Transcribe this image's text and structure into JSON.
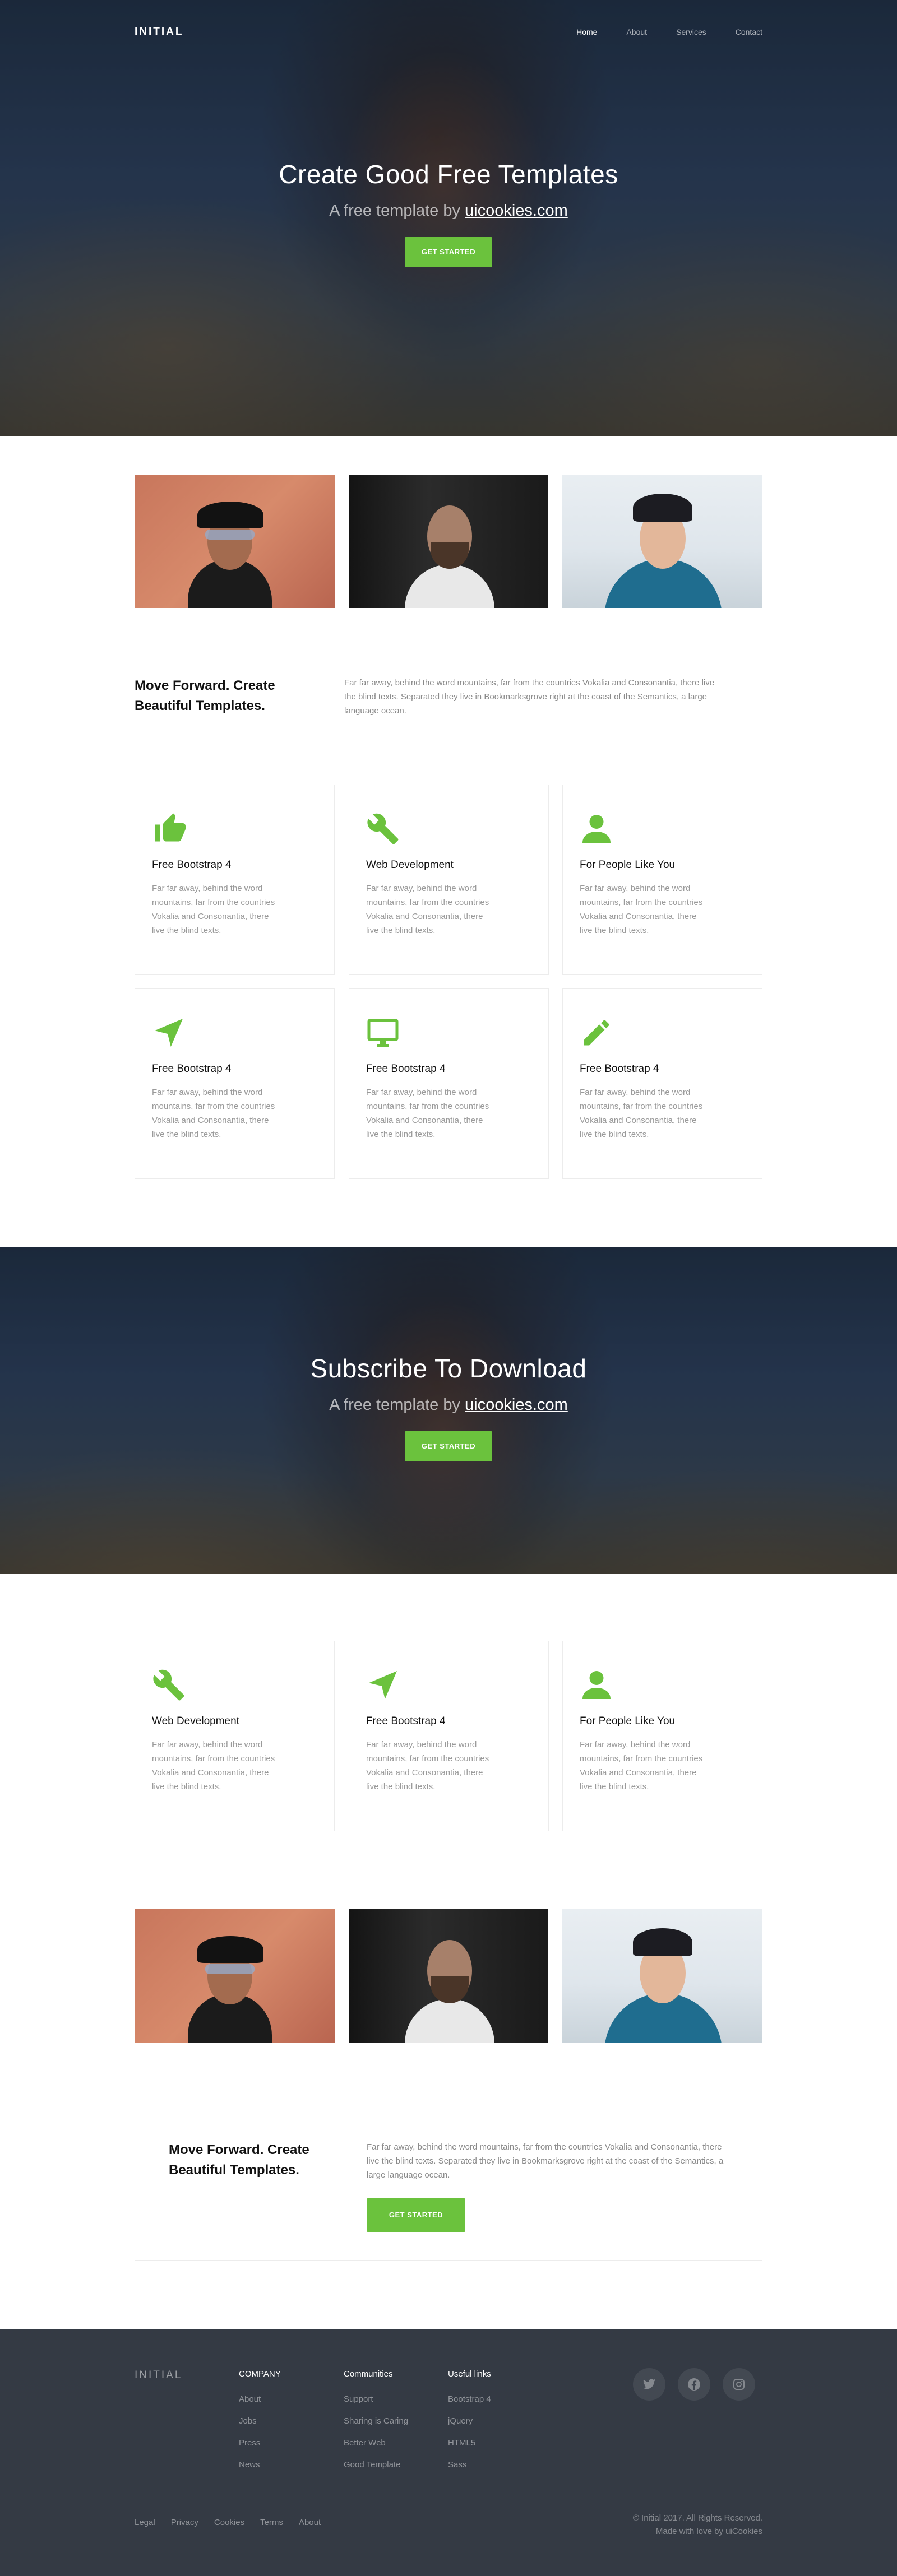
{
  "brand": {
    "logo": "INITIAL"
  },
  "nav": {
    "items": [
      {
        "label": "Home"
      },
      {
        "label": "About"
      },
      {
        "label": "Services"
      },
      {
        "label": "Contact"
      }
    ]
  },
  "hero": {
    "title": "Create Good Free Templates",
    "subtitle_prefix": "A free template by ",
    "subtitle_link": "uicookies.com",
    "button": "GET STARTED"
  },
  "intro": {
    "title": "Move Forward. Create Beautiful Templates.",
    "text": "Far far away, behind the word mountains, far from the countries Vokalia and Consonantia, there live the blind texts. Separated they live in Bookmarksgrove right at the coast of the Semantics, a large language ocean."
  },
  "features": [
    {
      "icon": "thumbs-up-icon",
      "title": "Free Bootstrap 4",
      "text": "Far far away, behind the word mountains, far from the countries Vokalia and Consonantia, there live the blind texts."
    },
    {
      "icon": "wrench-icon",
      "title": "Web Development",
      "text": "Far far away, behind the word mountains, far from the countries Vokalia and Consonantia, there live the blind texts."
    },
    {
      "icon": "user-icon",
      "title": "For People Like You",
      "text": "Far far away, behind the word mountains, far from the countries Vokalia and Consonantia, there live the blind texts."
    },
    {
      "icon": "navigation-arrow-icon",
      "title": "Free Bootstrap 4",
      "text": "Far far away, behind the word mountains, far from the countries Vokalia and Consonantia, there live the blind texts."
    },
    {
      "icon": "monitor-icon",
      "title": "Free Bootstrap 4",
      "text": "Far far away, behind the word mountains, far from the countries Vokalia and Consonantia, there live the blind texts."
    },
    {
      "icon": "pencil-icon",
      "title": "Free Bootstrap 4",
      "text": "Far far away, behind the word mountains, far from the countries Vokalia and Consonantia, there live the blind texts."
    }
  ],
  "subscribe": {
    "title": "Subscribe To Download",
    "subtitle_prefix": "A free template by ",
    "subtitle_link": "uicookies.com",
    "button": "GET STARTED"
  },
  "features2": [
    {
      "icon": "wrench-icon",
      "title": "Web Development",
      "text": "Far far away, behind the word mountains, far from the countries Vokalia and Consonantia, there live the blind texts."
    },
    {
      "icon": "navigation-arrow-icon",
      "title": "Free Bootstrap 4",
      "text": "Far far away, behind the word mountains, far from the countries Vokalia and Consonantia, there live the blind texts."
    },
    {
      "icon": "user-icon",
      "title": "For People Like You",
      "text": "Far far away, behind the word mountains, far from the countries Vokalia and Consonantia, there live the blind texts."
    }
  ],
  "cta": {
    "title": "Move Forward. Create Beautiful Templates.",
    "text": "Far far away, behind the word mountains, far from the countries Vokalia and Consonantia, there live the blind texts. Separated they live in Bookmarksgrove right at the coast of the Semantics, a large language ocean.",
    "button": "GET STARTED"
  },
  "footer": {
    "logo": "INITIAL",
    "columns": [
      {
        "heading": "COMPANY",
        "links": [
          "About",
          "Jobs",
          "Press",
          "News"
        ]
      },
      {
        "heading": "Communities",
        "links": [
          "Support",
          "Sharing is Caring",
          "Better Web",
          "Good Template"
        ]
      },
      {
        "heading": "Useful links",
        "links": [
          "Bootstrap 4",
          "jQuery",
          "HTML5",
          "Sass"
        ]
      }
    ],
    "socials": [
      "twitter-icon",
      "facebook-icon",
      "instagram-icon"
    ],
    "bottom_links": [
      "Legal",
      "Privacy",
      "Cookies",
      "Terms",
      "About"
    ],
    "copyright": "© Initial 2017. All Rights Reserved.",
    "credit": "Made with love by uiCookies"
  },
  "colors": {
    "accent": "#6bc23d",
    "footer_bg": "#343a44",
    "text_muted": "#9a9a9a"
  }
}
